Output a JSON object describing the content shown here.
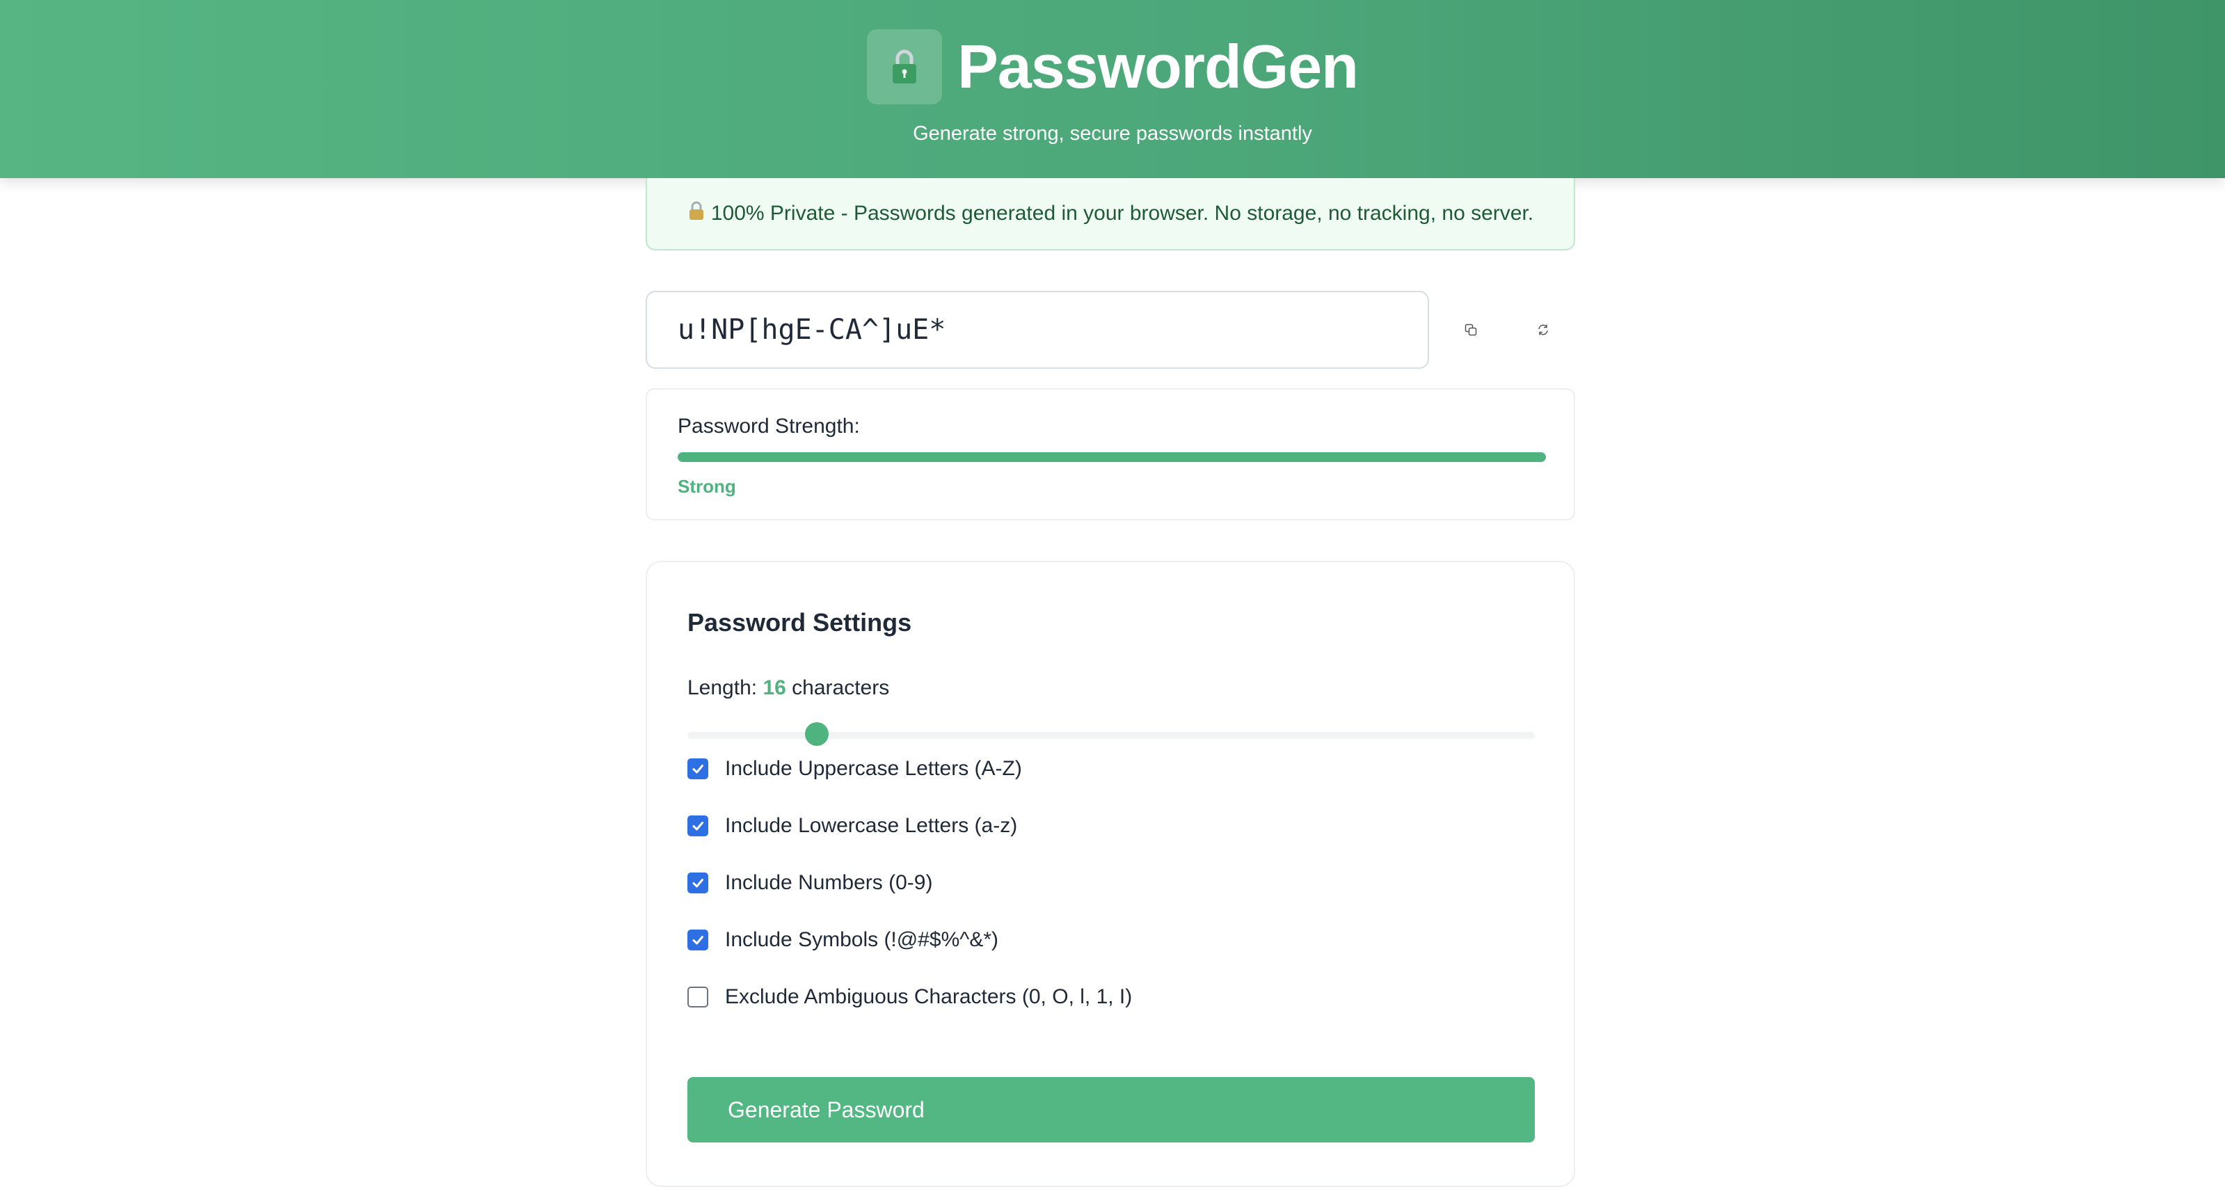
{
  "header": {
    "title": "PasswordGen",
    "subtitle": "Generate strong, secure passwords instantly",
    "logo_icon": "lock-icon"
  },
  "privacy": {
    "icon": "lock-icon",
    "text": "100% Private - Passwords generated in your browser. No storage, no tracking, no server."
  },
  "password": {
    "value": "u!NP[hgE-CA^]uE*",
    "copy_icon": "copy-icon",
    "regenerate_icon": "refresh-icon"
  },
  "strength": {
    "label": "Password Strength:",
    "value": "Strong",
    "level": 1.0
  },
  "settings": {
    "title": "Password Settings",
    "length_prefix": "Length:",
    "length_value": "16",
    "length_suffix": "characters",
    "slider_fraction": 0.153,
    "options": [
      {
        "label": "Include Uppercase Letters (A-Z)",
        "checked": true
      },
      {
        "label": "Include Lowercase Letters (a-z)",
        "checked": true
      },
      {
        "label": "Include Numbers (0-9)",
        "checked": true
      },
      {
        "label": "Include Symbols (!@#$%^&*)",
        "checked": true
      },
      {
        "label": "Exclude Ambiguous Characters (0, O, l, 1, I)",
        "checked": false
      }
    ],
    "generate_label": "Generate Password"
  },
  "colors": {
    "accent": "#4fb37f",
    "checkbox": "#2f6fe4"
  }
}
